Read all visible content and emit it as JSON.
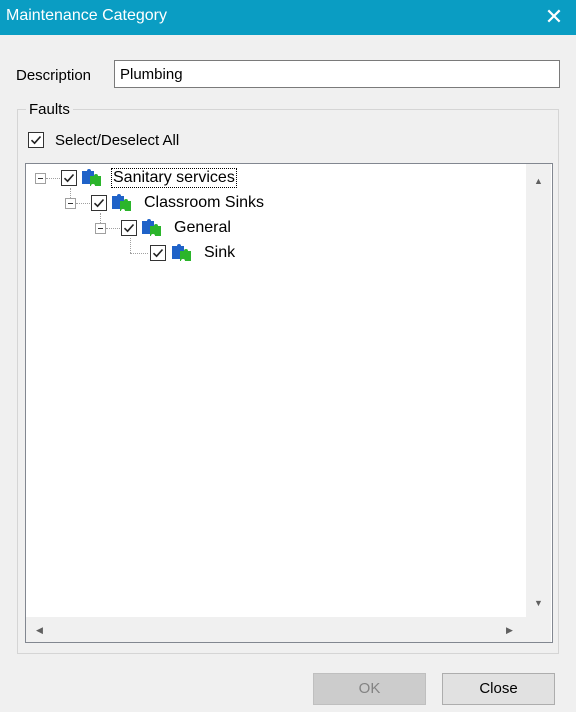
{
  "window": {
    "title": "Maintenance Category",
    "close_glyph": "✕"
  },
  "description": {
    "label": "Description",
    "value": "Plumbing"
  },
  "faults": {
    "legend": "Faults",
    "select_all": {
      "label": "Select/Deselect All",
      "checked": true
    },
    "tree": [
      {
        "label": "Sanitary services",
        "level": 0,
        "checked": true,
        "icon": "puzzle-icon",
        "focused": true
      },
      {
        "label": "Classroom Sinks",
        "level": 1,
        "checked": true,
        "icon": "puzzle-icon"
      },
      {
        "label": "General",
        "level": 2,
        "checked": true,
        "icon": "puzzle-icon"
      },
      {
        "label": "Sink",
        "level": 3,
        "checked": true,
        "icon": "puzzle-icon"
      }
    ]
  },
  "buttons": {
    "ok": "OK",
    "close": "Close"
  },
  "colors": {
    "titlebar": "#0a9dc3",
    "puzzle_blue": "#1f62c8",
    "puzzle_green": "#2bb52b"
  }
}
